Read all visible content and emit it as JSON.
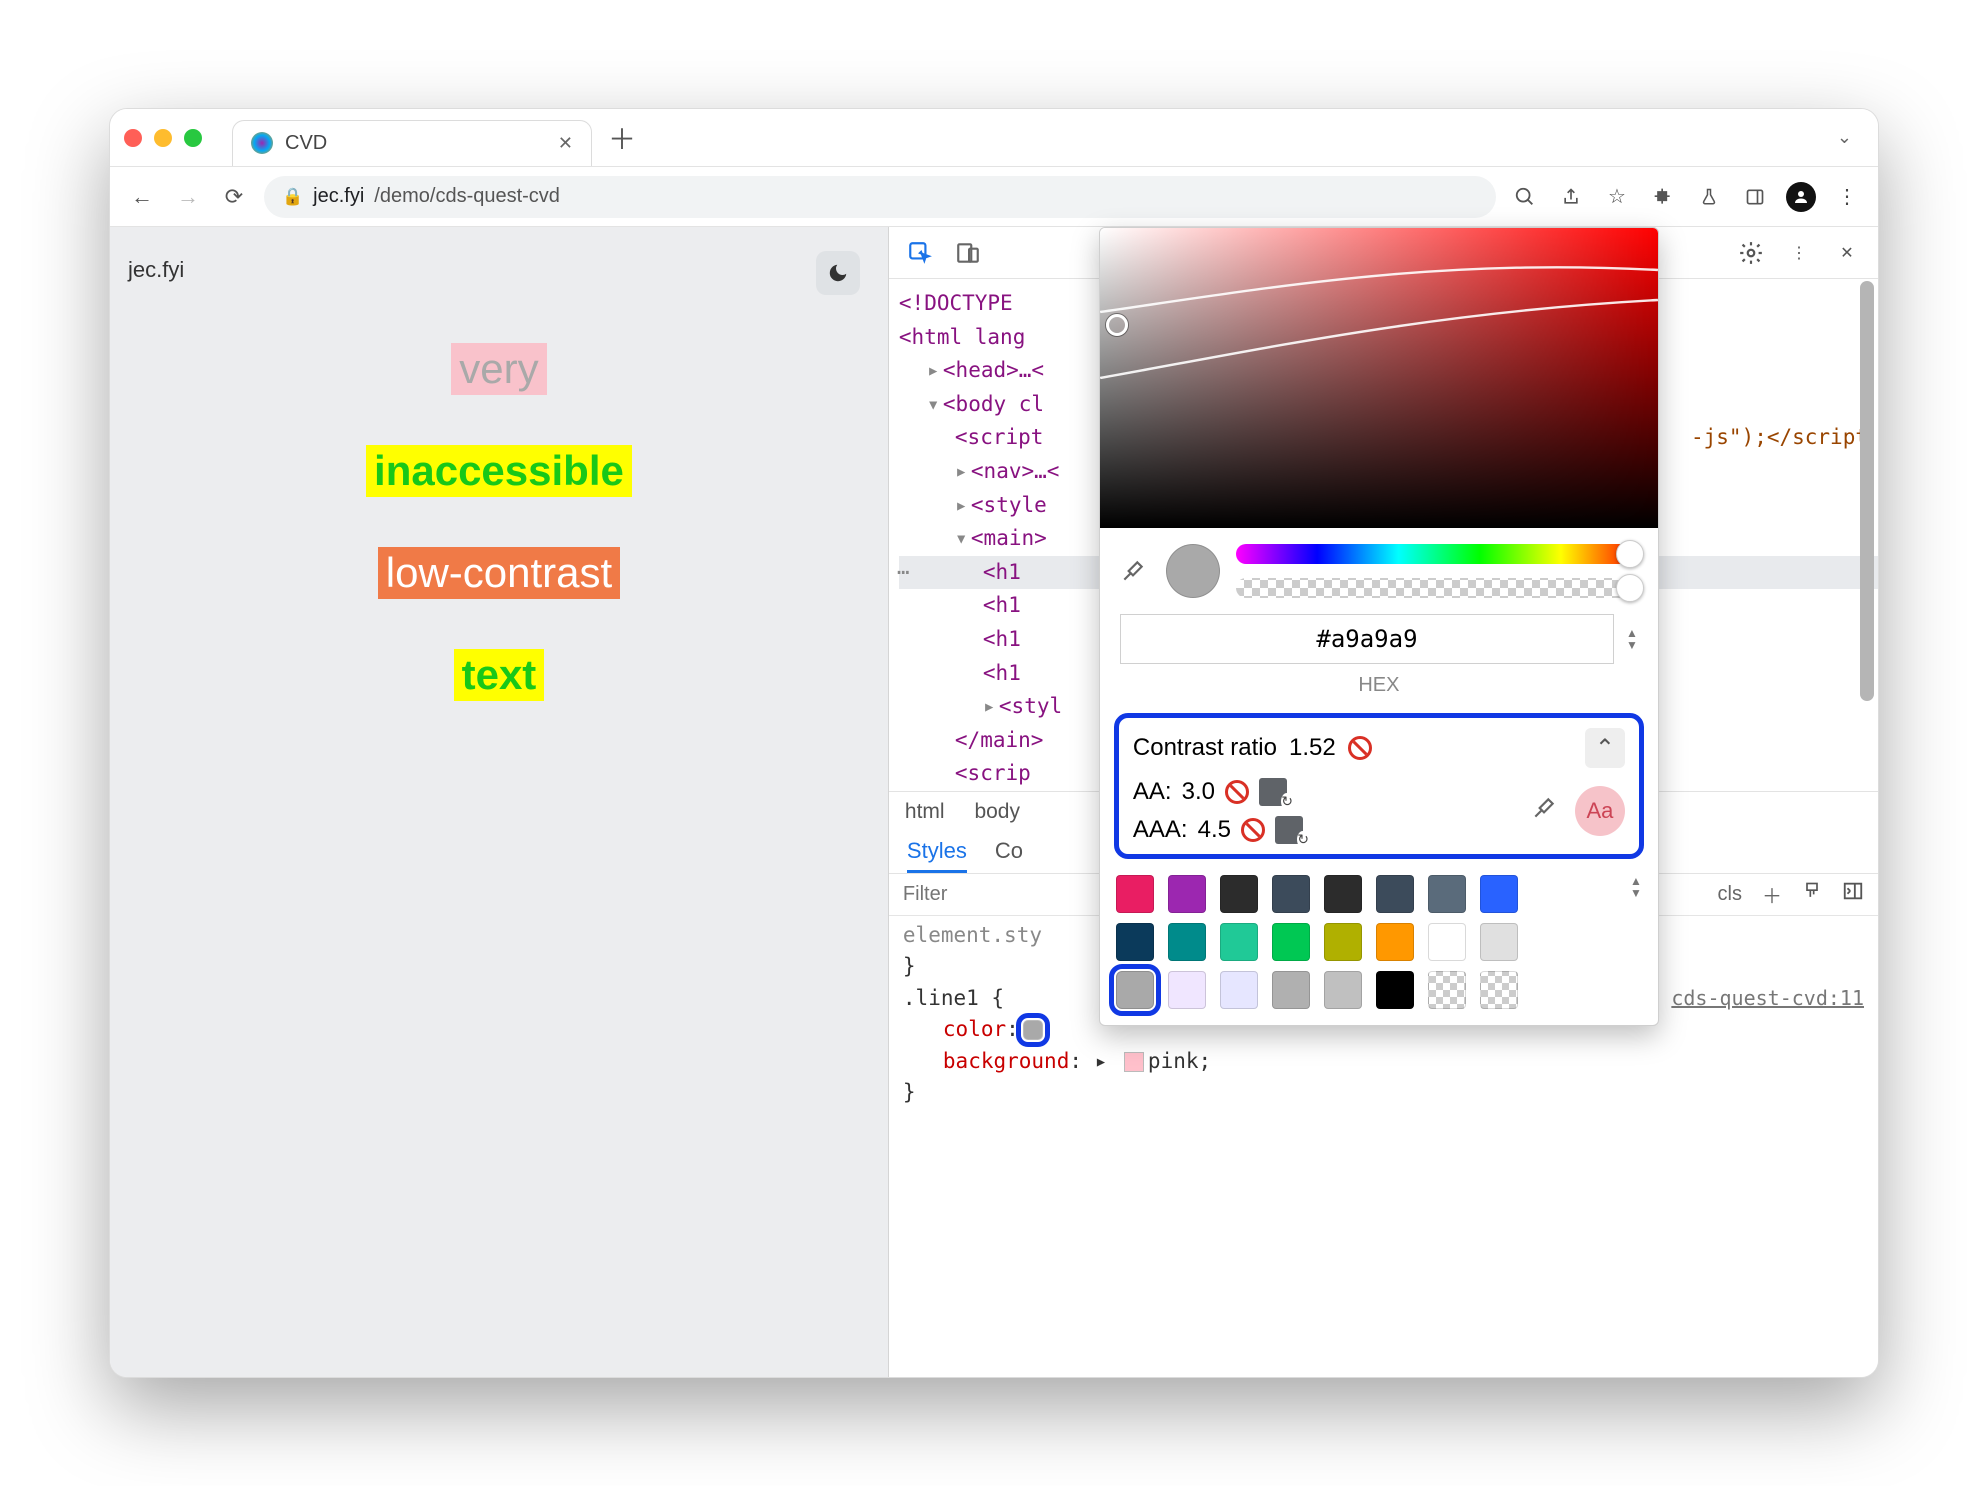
{
  "tab": {
    "title": "CVD"
  },
  "addressbar": {
    "domain": "jec.fyi",
    "path": "/demo/cds-quest-cvd"
  },
  "page": {
    "brand": "jec.fyi",
    "lines": [
      "very",
      "inaccessible",
      "low-contrast",
      "text"
    ]
  },
  "elements": {
    "doctype": "<!DOCTYPE",
    "html_open": "<html lang",
    "head": "<head>…<",
    "body": "<body cl",
    "script": "<script",
    "script_tail": "-js\");</script",
    "nav": "<nav>…<",
    "style": "<style",
    "main": "<main>",
    "h1": "<h1 ",
    "style2_open": "<styl",
    "main_close": "</main>",
    "script2_open": "<scrip"
  },
  "breadcrumb": [
    "html",
    "body"
  ],
  "styles_tabs": {
    "active": "Styles",
    "next": "Co"
  },
  "filter_placeholder": "Filter",
  "filter_right": {
    "cls": "cls"
  },
  "styles": {
    "element_style": "element.sty",
    "rule_selector": ".line1",
    "open_brace": "{",
    "prop_color": "color",
    "prop_bg": "background",
    "val_bg": "pink",
    "src": "cds-quest-cvd:11"
  },
  "color_picker": {
    "hex_value": "#a9a9a9",
    "hex_label": "HEX",
    "contrast": {
      "label": "Contrast ratio",
      "value": "1.52",
      "aa_label": "AA:",
      "aa_value": "3.0",
      "aaa_label": "AAA:",
      "aaa_value": "4.5",
      "sample": "Aa"
    },
    "swatches": [
      [
        "#e91e63",
        "#9c27b0",
        "#2c2c2c",
        "#3c4b5b",
        "#2c2c2c",
        "#3c4b5b",
        "#5a6b7b",
        "#2962ff"
      ],
      [
        "#0b3a5b",
        "#008b8b",
        "#20c997",
        "#00c853",
        "#b0b000",
        "#ff9800",
        "#ffffff",
        "#e0e0e0"
      ],
      [
        "#d0d0d0",
        "#f0e6ff",
        "#e6e6ff",
        "#b0b0b0",
        "#c0c0c0",
        "#000000",
        "checker",
        "checker"
      ]
    ],
    "selected_swatch": "#a9a9a9"
  }
}
